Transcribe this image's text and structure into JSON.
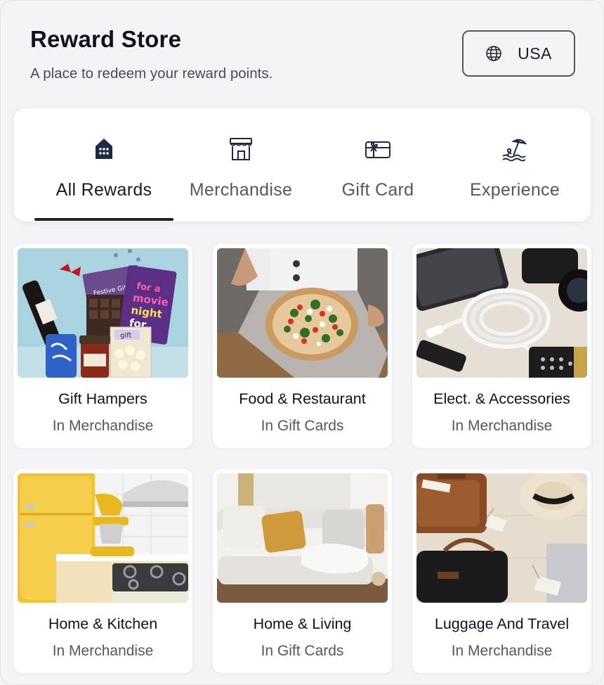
{
  "header": {
    "title": "Reward Store",
    "subtitle": "A place to redeem your reward points.",
    "country_button": {
      "label": "USA",
      "icon": "globe-icon"
    }
  },
  "tabs": [
    {
      "label": "All Rewards",
      "icon": "store-grid-icon",
      "active": true
    },
    {
      "label": "Merchandise",
      "icon": "storefront-icon",
      "active": false
    },
    {
      "label": "Gift Card",
      "icon": "gift-card-icon",
      "active": false
    },
    {
      "label": "Experience",
      "icon": "beach-umbrella-icon",
      "active": false
    }
  ],
  "cards": [
    {
      "title": "Gift Hampers",
      "category": "In Merchandise"
    },
    {
      "title": "Food & Restaurant",
      "category": "In Gift Cards"
    },
    {
      "title": "Elect. & Accessories",
      "category": "In Merchandise"
    },
    {
      "title": "Home & Kitchen",
      "category": "In Merchandise"
    },
    {
      "title": "Home & Living",
      "category": "In Gift Cards"
    },
    {
      "title": "Luggage And Travel",
      "category": "In Merchandise"
    }
  ],
  "image_text": {
    "festive": "Festive Gifting",
    "movie": "for a movie night for",
    "gift": "gift"
  },
  "colors": {
    "accent": "#1f1f30",
    "icon_dark": "#1e2a44",
    "page_bg": "#f4f4f7"
  }
}
